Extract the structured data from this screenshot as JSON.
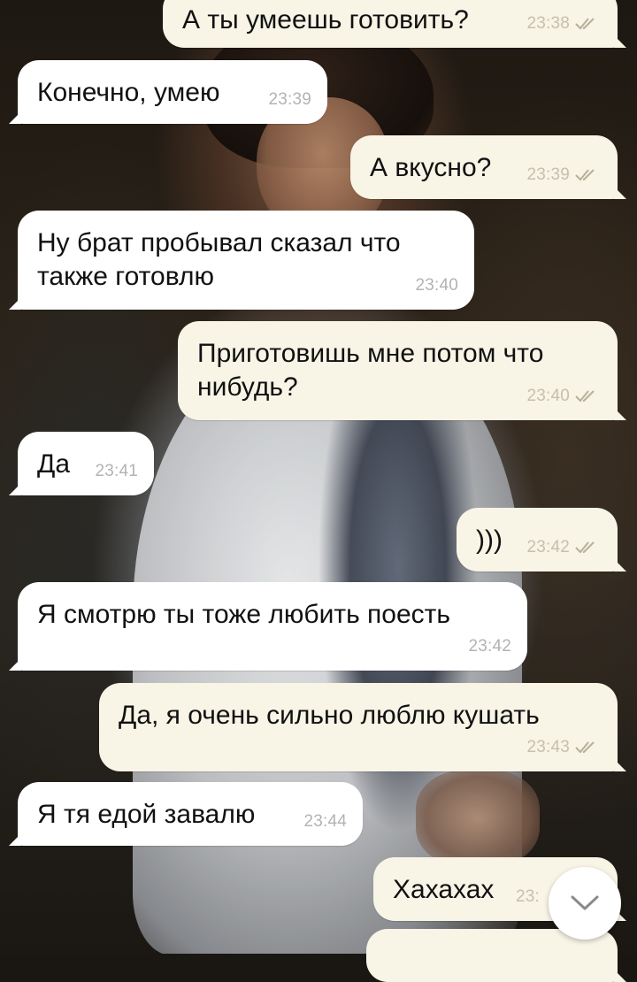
{
  "chat": {
    "messages": [
      {
        "direction": "out",
        "text": "А ты умеешь готовить?",
        "time": "23:38",
        "read": true
      },
      {
        "direction": "in",
        "text": "Конечно, умею",
        "time": "23:39"
      },
      {
        "direction": "out",
        "text": "А вкусно?",
        "time": "23:39",
        "read": true
      },
      {
        "direction": "in",
        "text": "Ну брат пробывал сказал что также готовлю",
        "time": "23:40"
      },
      {
        "direction": "out",
        "text": "Приготовишь мне потом что нибудь?",
        "time": "23:40",
        "read": true
      },
      {
        "direction": "in",
        "text": "Да",
        "time": "23:41"
      },
      {
        "direction": "out",
        "text": ")))",
        "time": "23:42",
        "read": true
      },
      {
        "direction": "in",
        "text": "Я смотрю ты тоже любить поесть",
        "time": "23:42"
      },
      {
        "direction": "out",
        "text": "Да, я очень сильно люблю кушать",
        "time": "23:43",
        "read": true
      },
      {
        "direction": "in",
        "text": "Я тя едой завалю",
        "time": "23:44"
      },
      {
        "direction": "out",
        "text": "Хахахах",
        "time": "23:",
        "read": true
      }
    ]
  },
  "icons": {
    "read_receipt": "double-check-icon",
    "scroll_down": "chevron-down-icon"
  },
  "colors": {
    "incoming_bubble": "#ffffff",
    "outgoing_bubble": "#f8f4e6",
    "timestamp": "#b3b3b3",
    "check": "#b7b09a"
  }
}
